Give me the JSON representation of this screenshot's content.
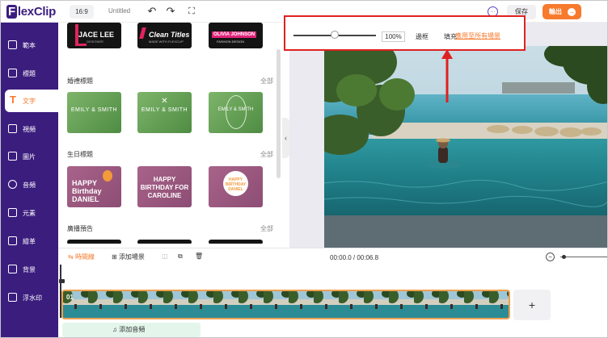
{
  "header": {
    "logo": "lexClip",
    "logo_mark": "F",
    "ratio": "16:9",
    "project_title": "Untitled",
    "save_label": "保存",
    "export_label": "輸出",
    "help_label": "…"
  },
  "sidebar": {
    "items": [
      {
        "label": "範本"
      },
      {
        "label": "標題"
      },
      {
        "label": "文字",
        "active": true
      },
      {
        "label": "視頻"
      },
      {
        "label": "圖片"
      },
      {
        "label": "音頻"
      },
      {
        "label": "元素"
      },
      {
        "label": "繪革"
      },
      {
        "label": "背景"
      },
      {
        "label": "浮水印"
      }
    ]
  },
  "library": {
    "top_tiles": [
      {
        "text": "JACE LEE",
        "sub": "DESIGNER"
      },
      {
        "text": "Clean Titles",
        "sub": "MADE WITH FLEXCLIP"
      },
      {
        "text": "OLIVIA JOHNSON",
        "sub": "FASHION DESIGN"
      }
    ],
    "categories": [
      {
        "title": "婚禮標題",
        "all": "全部",
        "tiles": [
          "EMILY & SMITH",
          "EMILY & SMITH",
          "EMILY & SMITH"
        ]
      },
      {
        "title": "生日標題",
        "all": "全部",
        "tiles": [
          "HAPPY Birthday DANIEL",
          "HAPPY BIRTHDAY FOR CAROLINE",
          "HAPPY BIRTHDAY DANIEL"
        ]
      },
      {
        "title": "廣播預告",
        "all": "全部"
      }
    ]
  },
  "toolbar": {
    "zoom": "100%",
    "zoom_level": 0.5,
    "option_left": "邊框",
    "option_fill": "填充",
    "apply_all": "應用至所有場景"
  },
  "timeline": {
    "tab_timeline": "時間線",
    "add_scene": "添加場景",
    "time": "00:00.0 / 00:06.8",
    "clip_number": "01",
    "add_audio": "添加音頻",
    "add_clip": "+"
  },
  "colors": {
    "brand": "#3b1d7e",
    "accent": "#f77a2d",
    "highlight": "#e02020"
  }
}
